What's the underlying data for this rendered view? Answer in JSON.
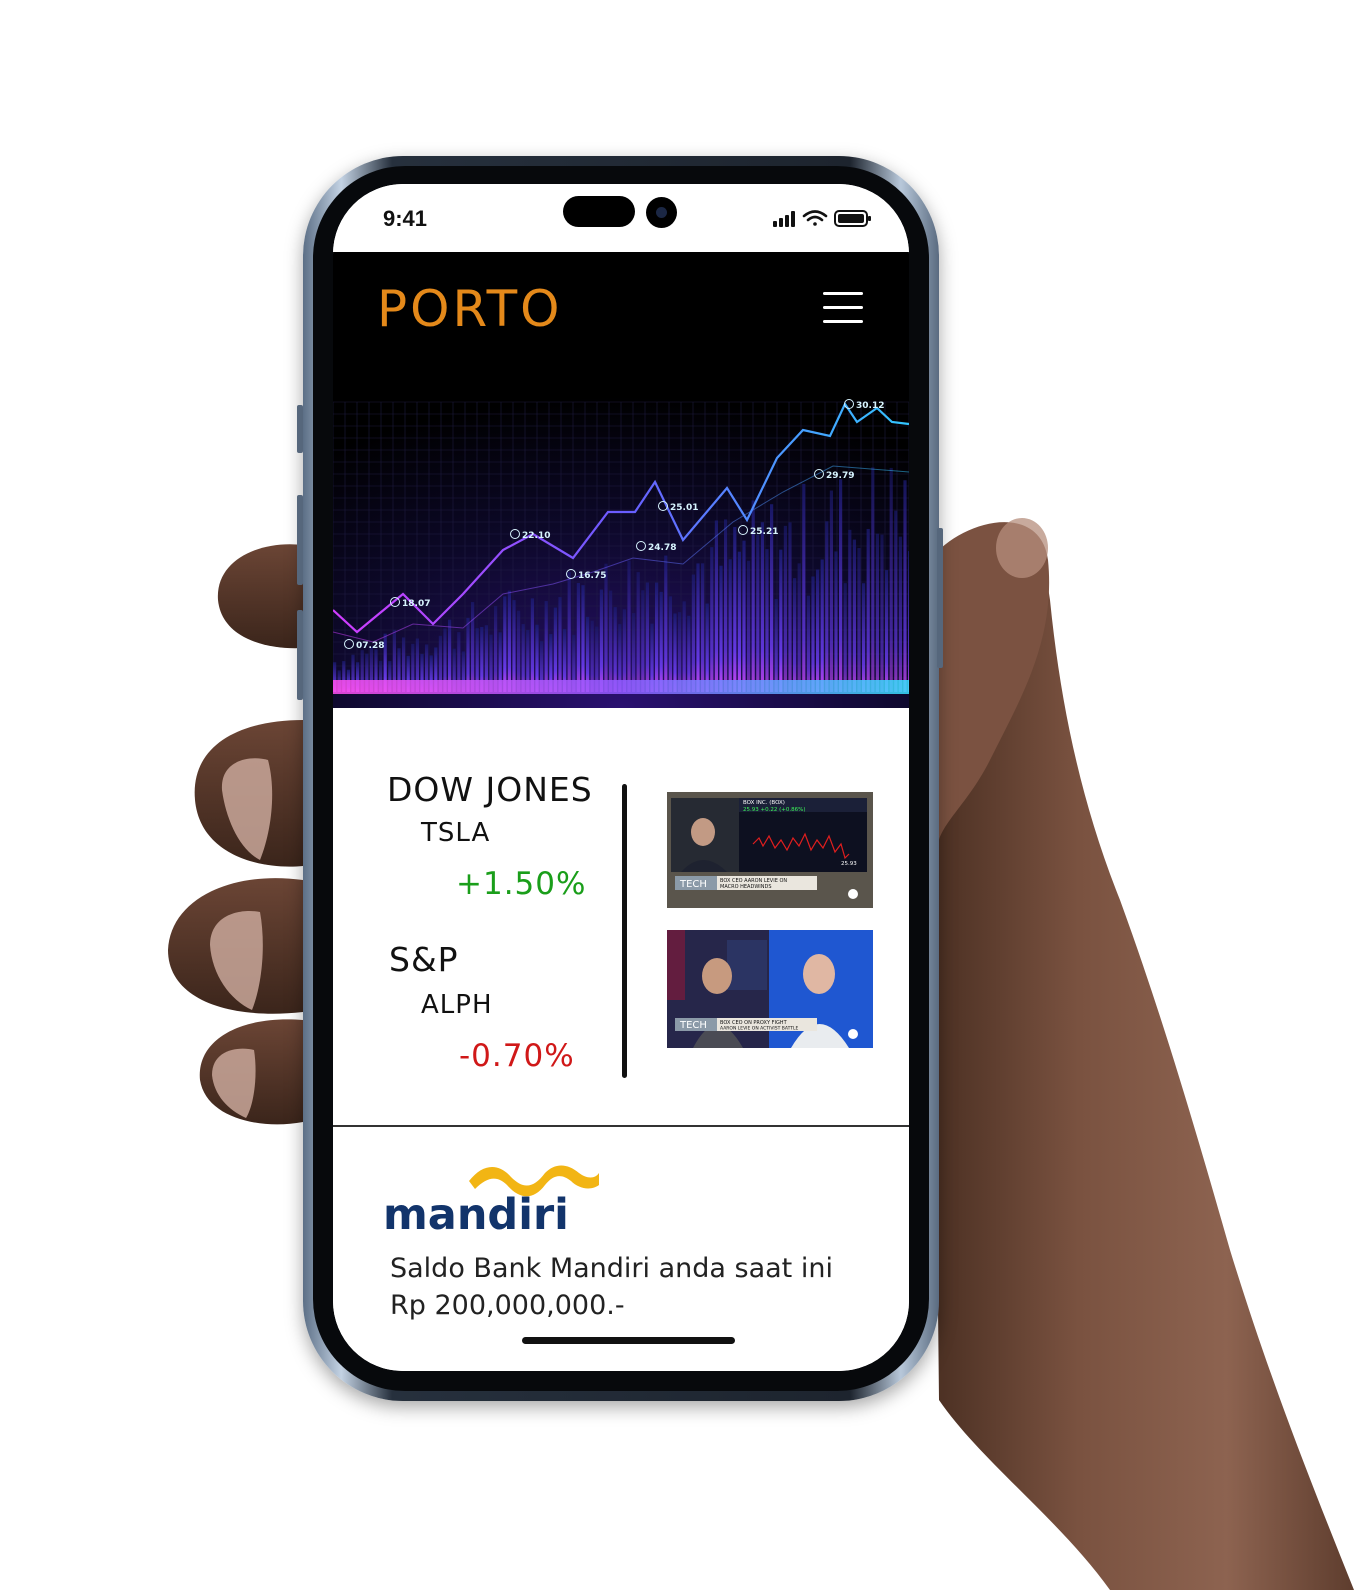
{
  "status_bar": {
    "time": "9:41"
  },
  "app": {
    "title": "PORTO",
    "menu_icon": "hamburger-menu-icon"
  },
  "hero_chart": {
    "labels": [
      "07.28",
      "18.07",
      "22.10",
      "16.75",
      "24.78",
      "25.01",
      "25.21",
      "29.79",
      "30.12"
    ]
  },
  "markets": [
    {
      "index": "DOW JONES",
      "ticker": "TSLA",
      "change": "+1.50%",
      "color": "#1a9e1a"
    },
    {
      "index": "S&P",
      "ticker": "ALPH",
      "change": "-0.70%",
      "color": "#d01818"
    }
  ],
  "videos": [
    {
      "channel_tag": "TECH",
      "headline_1": "BOX CEO AARON LEVIE ON",
      "headline_2": "MACRO HEADWINDS",
      "ticker_name": "BOX INC. (BOX)",
      "ticker_quote": "25.93 +0.22 (+0.86%)",
      "last_price": "25.93"
    },
    {
      "channel_tag": "TECH",
      "headline_1": "BOX CEO ON PROXY FIGHT",
      "headline_2": "AARON LEVIE ON ACTIVIST BATTLE"
    }
  ],
  "bank": {
    "name": "mandiri",
    "line1": "Saldo Bank Mandiri anda saat ini",
    "line2": "Rp 200,000,000.-"
  }
}
